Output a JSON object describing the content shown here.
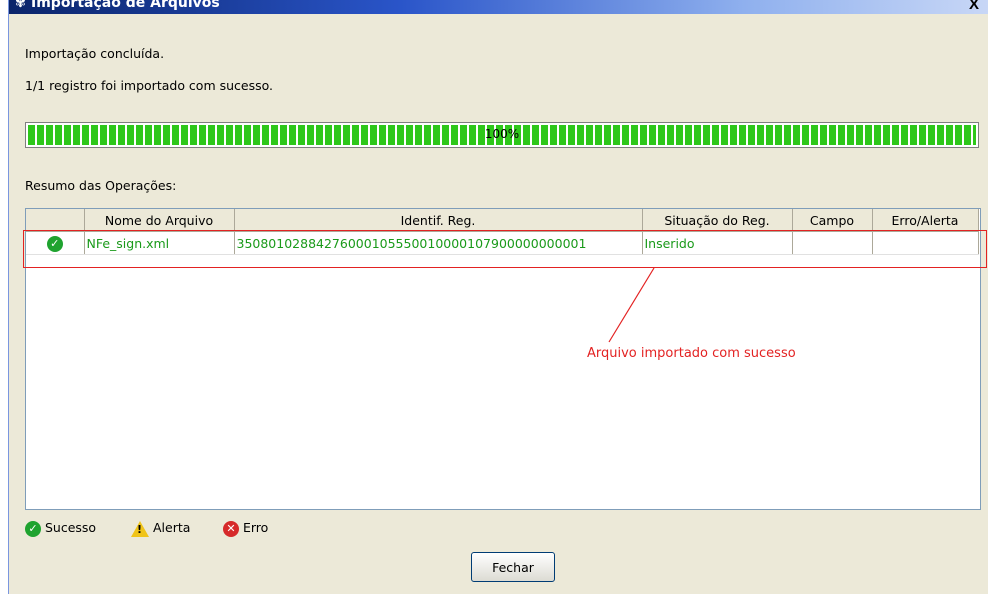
{
  "window": {
    "title": "Importação de Arquivos",
    "close_label": "X"
  },
  "messages": {
    "line1": "Importação concluída.",
    "line2": "1/1 registro foi importado com sucesso."
  },
  "progress": {
    "value": 100,
    "label": "100%"
  },
  "summary_label": "Resumo das Operações:",
  "table": {
    "columns": [
      "",
      "Nome do Arquivo",
      "Identif. Reg.",
      "Situação do Reg.",
      "Campo",
      "Erro/Alerta"
    ],
    "rows": [
      {
        "status_icon": "success-check-icon",
        "file": "NFe_sign.xml",
        "id": "35080102884276000105550010000107900000000001",
        "situation": "Inserido",
        "field": "",
        "error": ""
      }
    ]
  },
  "annotation": {
    "text": "Arquivo importado com sucesso",
    "color": "#e32222"
  },
  "legend": {
    "success": "Sucesso",
    "alert": "Alerta",
    "error": "Erro"
  },
  "buttons": {
    "close": "Fechar"
  },
  "colors": {
    "progress": "#2ec71a",
    "status_text": "#1a9a1a",
    "title_bar": "#0a246a"
  }
}
